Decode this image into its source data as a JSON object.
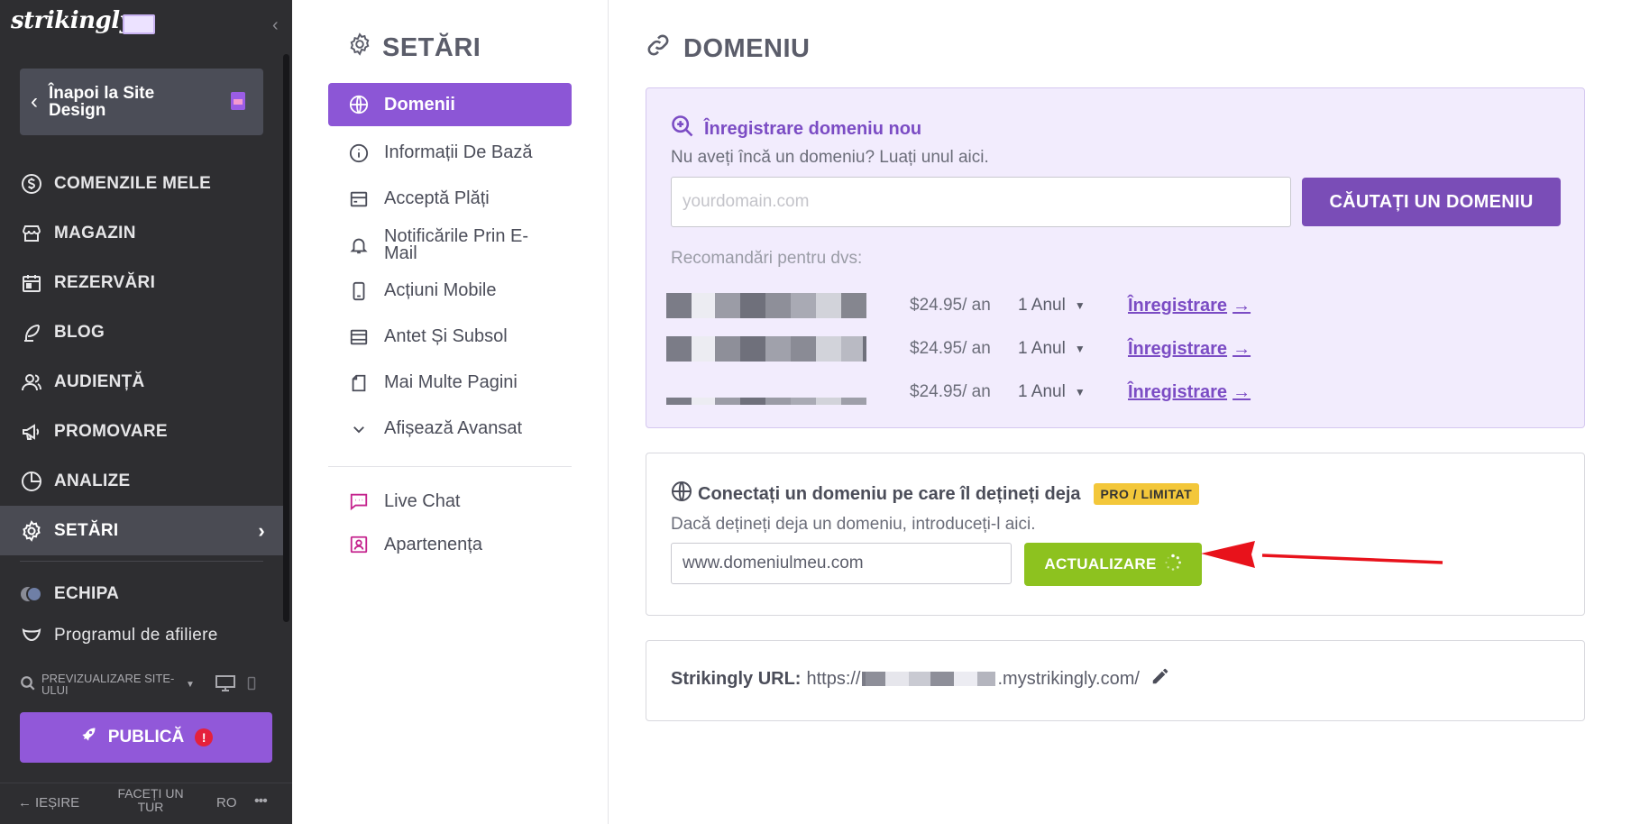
{
  "sidebar": {
    "logo": "strikingly",
    "back_label": "Înapoi la Site Design",
    "items": [
      {
        "label": "COMENZILE MELE",
        "icon": "dollar-circle-icon"
      },
      {
        "label": "MAGAZIN",
        "icon": "store-icon"
      },
      {
        "label": "REZERVĂRI",
        "icon": "calendar-icon"
      },
      {
        "label": "BLOG",
        "icon": "feather-icon"
      },
      {
        "label": "AUDIENȚĂ",
        "icon": "users-icon"
      },
      {
        "label": "PROMOVARE",
        "icon": "megaphone-icon"
      },
      {
        "label": "ANALIZE",
        "icon": "pie-chart-icon"
      },
      {
        "label": "SETĂRI",
        "icon": "gear-icon"
      }
    ],
    "team_label": "ECHIPA",
    "affiliate_label": "Programul de afiliere",
    "preview_label": "PREVIZUALIZARE SITE-ULUI",
    "publish_label": "PUBLICĂ",
    "publish_warning": "!",
    "exit_label": "IEȘIRE",
    "tour_label": "FACEȚI UN TUR",
    "language": "RO",
    "more": "•••"
  },
  "settings_menu": {
    "title": "SETĂRI",
    "items": [
      {
        "label": "Domenii",
        "icon": "globe-icon"
      },
      {
        "label": "Informații De Bază",
        "icon": "info-icon"
      },
      {
        "label": "Acceptă Plăți",
        "icon": "credit-card-icon"
      },
      {
        "label": "Notificările Prin E-Mail",
        "icon": "bell-icon"
      },
      {
        "label": "Acțiuni Mobile",
        "icon": "mobile-icon"
      },
      {
        "label": "Antet Și Subsol",
        "icon": "layout-icon"
      },
      {
        "label": "Mai Multe Pagini",
        "icon": "pages-icon"
      },
      {
        "label": "Afișează Avansat",
        "icon": "chevron-down-icon"
      }
    ],
    "extras": [
      {
        "label": "Live Chat",
        "icon": "chat-icon"
      },
      {
        "label": "Apartenența",
        "icon": "member-icon"
      }
    ]
  },
  "main": {
    "title": "DOMENIU",
    "register": {
      "title": "Înregistrare domeniu nou",
      "subtitle": "Nu aveți încă un domeniu? Luați unul aici.",
      "placeholder": "yourdomain.com",
      "search_button": "CĂUTAȚI UN DOMENIU",
      "recommendations_label": "Recomandări pentru dvs:",
      "recommendations": [
        {
          "price": "$24.95/ an",
          "term": "1 Anul",
          "action": "Înregistrare"
        },
        {
          "price": "$24.95/ an",
          "term": "1 Anul",
          "action": "Înregistrare"
        },
        {
          "price": "$24.95/ an",
          "term": "1 Anul",
          "action": "Înregistrare"
        }
      ]
    },
    "connect": {
      "title": "Conectați un domeniu pe care îl dețineți deja",
      "badge": "PRO / LIMITAT",
      "subtitle": "Dacă dețineți deja un domeniu, introduceți-l aici.",
      "input_value": "www.domeniulmeu.com",
      "update_button": "ACTUALIZARE"
    },
    "url": {
      "label": "Strikingly URL:",
      "prefix": "https://",
      "suffix": ".mystrikingly.com/"
    }
  },
  "colors": {
    "sidebar_bg": "#2e2e31",
    "accent_purple": "#8c56d6",
    "update_green": "#8dc21f",
    "badge_yellow": "#f3c73a",
    "annotation_red": "#e8121b"
  }
}
